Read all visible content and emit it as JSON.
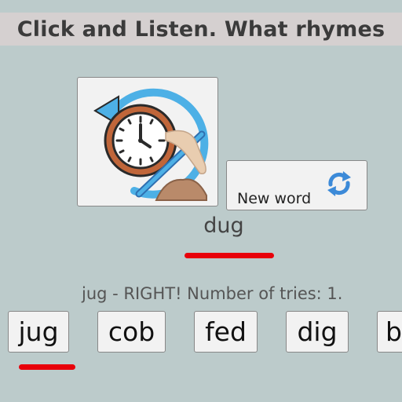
{
  "header": {
    "title": "Click and Listen. What rhymes"
  },
  "picture": {
    "icon": "clock-history-icon"
  },
  "new_word_button": {
    "label": "New word",
    "icon": "refresh-icon"
  },
  "target": {
    "word": "dug"
  },
  "status": {
    "text": "jug - RIGHT! Number of tries: 1."
  },
  "choices": [
    "jug",
    "cob",
    "fed",
    "dig",
    "b"
  ],
  "colors": {
    "background": "#bccbcb",
    "header_bg": "#d5d0d0",
    "underline": "#e8000a",
    "refresh": "#3c8ad8"
  }
}
